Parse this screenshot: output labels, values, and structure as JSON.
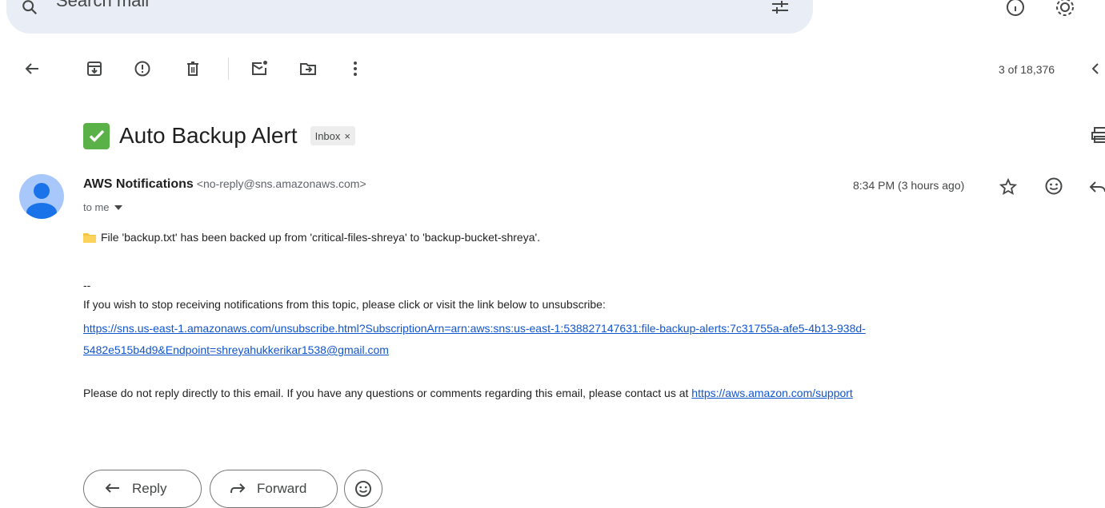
{
  "search": {
    "placeholder": "Search mail"
  },
  "toolbar": {
    "back": "back-arrow-icon",
    "archive": "archive-icon",
    "report_spam": "report-spam-icon",
    "delete": "trash-icon",
    "mark_unread": "mark-unread-icon",
    "move_to": "move-to-folder-icon",
    "more": "more-vertical-icon",
    "counter": "3 of 18,376"
  },
  "email": {
    "subject": "Auto Backup Alert",
    "label": "Inbox",
    "label_remove": "×",
    "sender_name": "AWS Notifications",
    "sender_email": "<no-reply@sns.amazonaws.com>",
    "to": "to me",
    "time": "8:34 PM (3 hours ago)",
    "body": {
      "line1": "File 'backup.txt' has been backed up from 'critical-files-shreya' to 'backup-bucket-shreya'.",
      "separator": "--",
      "unsubscribe_text": "If you wish to stop receiving notifications from this topic, please click or visit the link below to unsubscribe:",
      "unsubscribe_link_line1": "https://sns.us-east-1.amazonaws.com/unsubscribe.html?SubscriptionArn=arn:aws:sns:us-east-1:538827147631:file-backup-alerts:7c31755a-afe5-4b13-938d-",
      "unsubscribe_link_line2": "5482e515b4d9&Endpoint=shreyahukkerikar1538@gmail.com",
      "support_text": "Please do not reply directly to this email. If you have any questions or comments regarding this email, please contact us at ",
      "support_link": "https://aws.amazon.com/support"
    }
  },
  "actions": {
    "reply": "Reply",
    "forward": "Forward"
  },
  "colors": {
    "link": "#1155cc",
    "search_bg": "#e9eef6",
    "check_green": "#5ab147",
    "avatar": "#a8c7fa"
  }
}
